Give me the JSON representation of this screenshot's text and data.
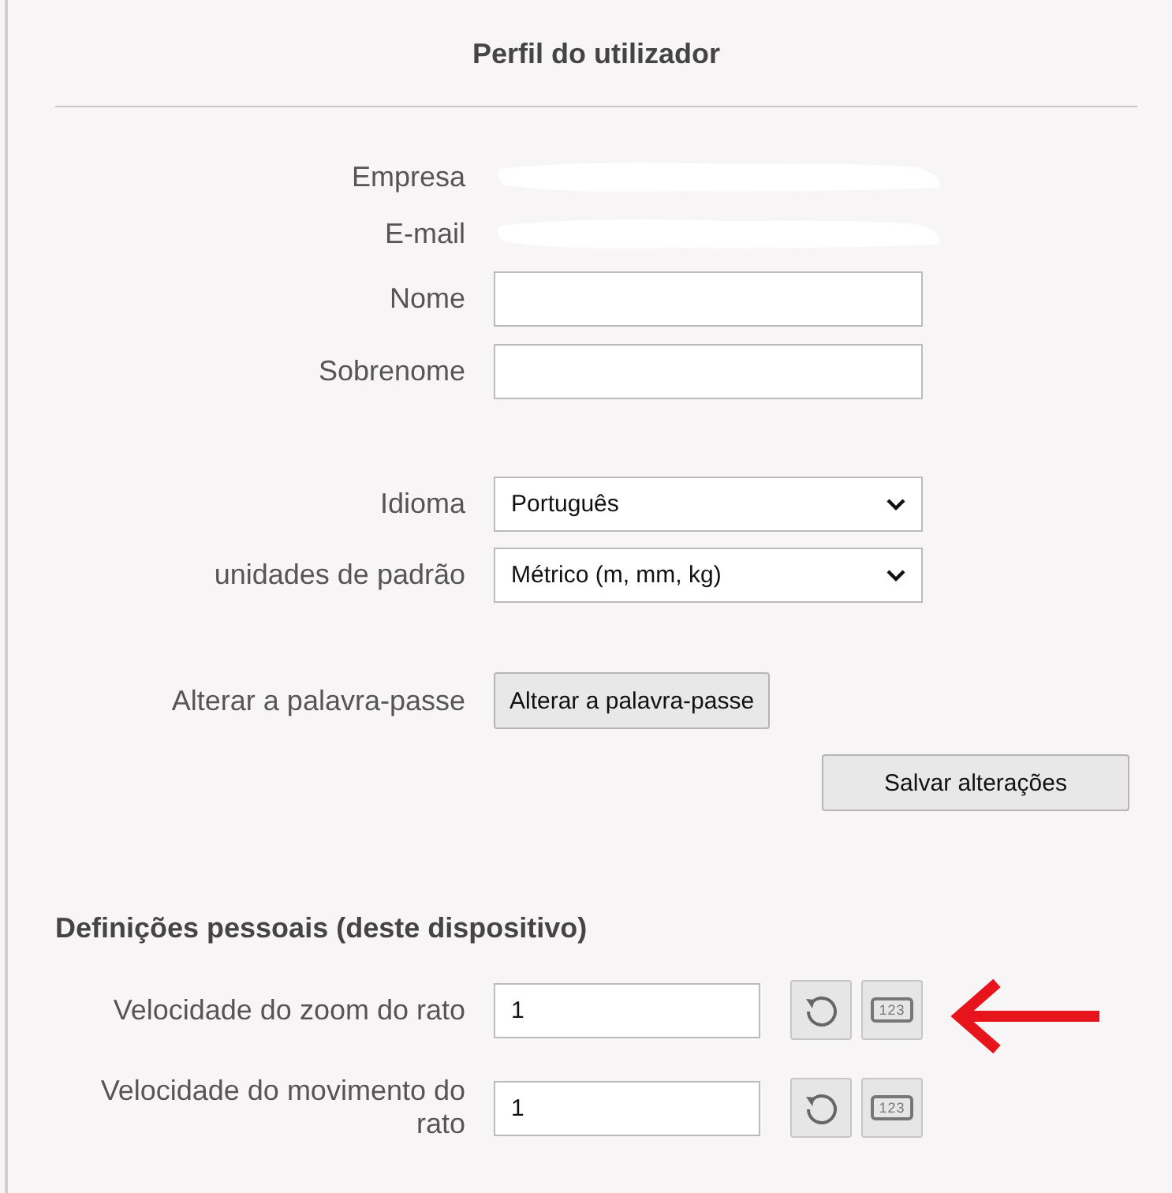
{
  "title": "Perfil do utilizador",
  "groups": [
    {
      "fields": [
        {
          "kind": "redacted",
          "label": "Empresa"
        },
        {
          "kind": "redacted",
          "label": "E-mail"
        },
        {
          "kind": "text",
          "label": "Nome"
        },
        {
          "kind": "text",
          "label": "Sobrenome"
        }
      ]
    },
    {
      "fields": [
        {
          "kind": "select",
          "label": "Idioma",
          "value": "Português"
        },
        {
          "kind": "select",
          "label": "unidades de padrão",
          "value": "Métrico (m, mm, kg)"
        }
      ]
    },
    {
      "fields": [
        {
          "kind": "button",
          "label": "Alterar a palavra-passe",
          "button": "Alterar a palavra-passe"
        }
      ]
    }
  ],
  "save_button": "Salvar alterações",
  "personal": {
    "heading": "Definições pessoais (deste dispositivo)",
    "settings": [
      {
        "label": "Velocidade do zoom do rato",
        "value": "1",
        "keypad_label": "123",
        "highlighted": true
      },
      {
        "label": "Velocidade do movimento do rato",
        "value": "1",
        "keypad_label": "123",
        "highlighted": false
      }
    ]
  }
}
